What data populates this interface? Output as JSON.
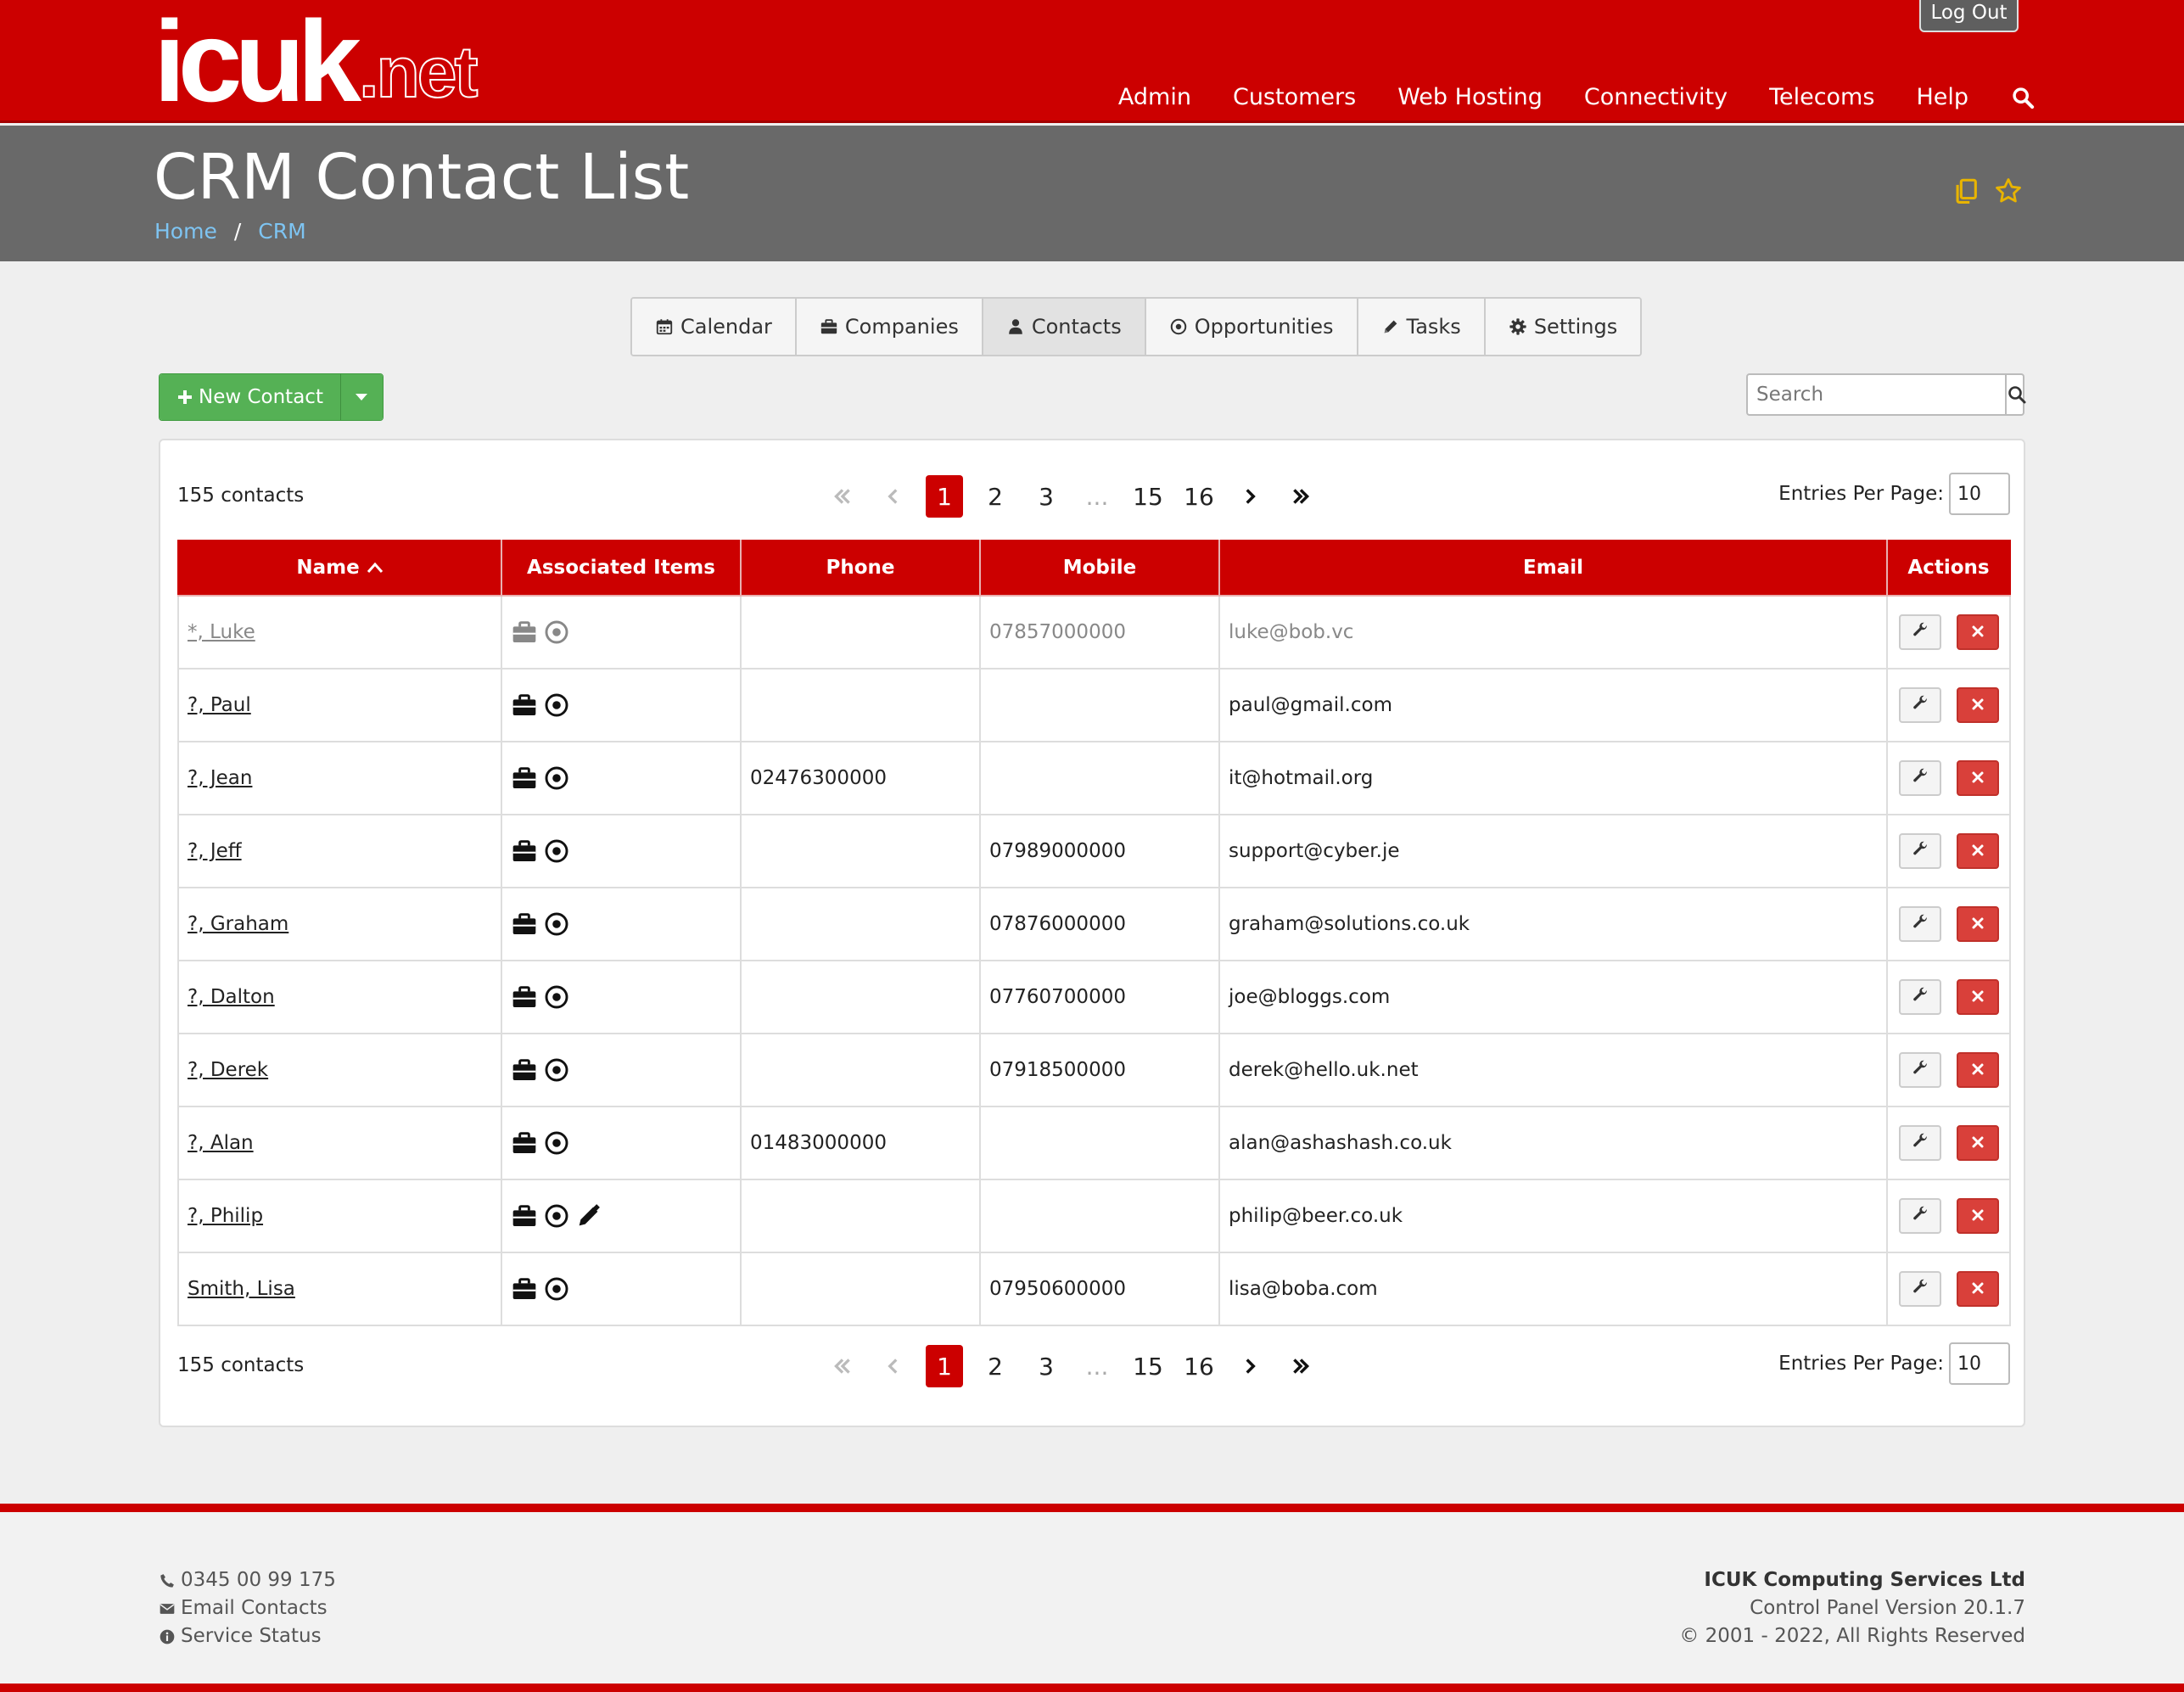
{
  "header": {
    "logo_main": "icuk",
    "logo_suffix": ".net",
    "logout_label": "Log Out",
    "nav": [
      "Admin",
      "Customers",
      "Web Hosting",
      "Connectivity",
      "Telecoms",
      "Help"
    ]
  },
  "page": {
    "title": "CRM Contact List",
    "breadcrumb": [
      "Home",
      "CRM"
    ],
    "breadcrumb_separator": "/"
  },
  "tabs": [
    {
      "label": "Calendar",
      "icon": "calendar-icon"
    },
    {
      "label": "Companies",
      "icon": "briefcase-icon"
    },
    {
      "label": "Contacts",
      "icon": "user-icon",
      "active": true
    },
    {
      "label": "Opportunities",
      "icon": "target-icon"
    },
    {
      "label": "Tasks",
      "icon": "pencil-icon"
    },
    {
      "label": "Settings",
      "icon": "gear-icon"
    }
  ],
  "toolbar": {
    "new_contact_label": "New Contact",
    "search_placeholder": "Search"
  },
  "list": {
    "count_label": "155 contacts",
    "pagination": [
      "1",
      "2",
      "3",
      "...",
      "15",
      "16"
    ],
    "current_page": "1",
    "entries_label": "Entries Per Page:",
    "entries_value": "10",
    "columns": [
      "Name",
      "Associated Items",
      "Phone",
      "Mobile",
      "Email",
      "Actions"
    ],
    "rows": [
      {
        "name": "*, Luke",
        "phone": "",
        "mobile": "07857000000",
        "email": "luke@bob.vc",
        "muted": true,
        "items": [
          "briefcase",
          "target"
        ]
      },
      {
        "name": "?, Paul",
        "phone": "",
        "mobile": "",
        "email": "paul@gmail.com",
        "items": [
          "briefcase",
          "target"
        ]
      },
      {
        "name": "?, Jean",
        "phone": "02476300000",
        "mobile": "",
        "email": "it@hotmail.org",
        "items": [
          "briefcase",
          "target"
        ]
      },
      {
        "name": "?, Jeff",
        "phone": "",
        "mobile": "07989000000",
        "email": "support@cyber.je",
        "items": [
          "briefcase",
          "target"
        ]
      },
      {
        "name": "?, Graham",
        "phone": "",
        "mobile": "07876000000",
        "email": "graham@solutions.co.uk",
        "items": [
          "briefcase",
          "target"
        ]
      },
      {
        "name": "?, Dalton",
        "phone": "",
        "mobile": "07760700000",
        "email": "joe@bloggs.com",
        "items": [
          "briefcase",
          "target"
        ]
      },
      {
        "name": "?, Derek",
        "phone": "",
        "mobile": "07918500000",
        "email": "derek@hello.uk.net",
        "items": [
          "briefcase",
          "target"
        ]
      },
      {
        "name": "?, Alan",
        "phone": "01483000000",
        "mobile": "",
        "email": "alan@ashashash.co.uk",
        "items": [
          "briefcase",
          "target"
        ]
      },
      {
        "name": "?, Philip",
        "phone": "",
        "mobile": "",
        "email": "philip@beer.co.uk",
        "items": [
          "briefcase",
          "target",
          "pencil"
        ]
      },
      {
        "name": "Smith, Lisa",
        "phone": "",
        "mobile": "07950600000",
        "email": "lisa@boba.com",
        "items": [
          "briefcase",
          "target"
        ]
      }
    ]
  },
  "footer": {
    "phone": "0345 00 99 175",
    "email_link": "Email Contacts",
    "status_link": "Service Status",
    "company": "ICUK Computing Services Ltd",
    "version": "Control Panel Version 20.1.7",
    "copyright": "© 2001 - 2022, All Rights Reserved"
  },
  "colors": {
    "brand_red": "#cc0000",
    "title_band": "#696969",
    "new_button_green": "#55b155",
    "delete_red": "#d9403a",
    "star_gold": "#e8b400"
  }
}
